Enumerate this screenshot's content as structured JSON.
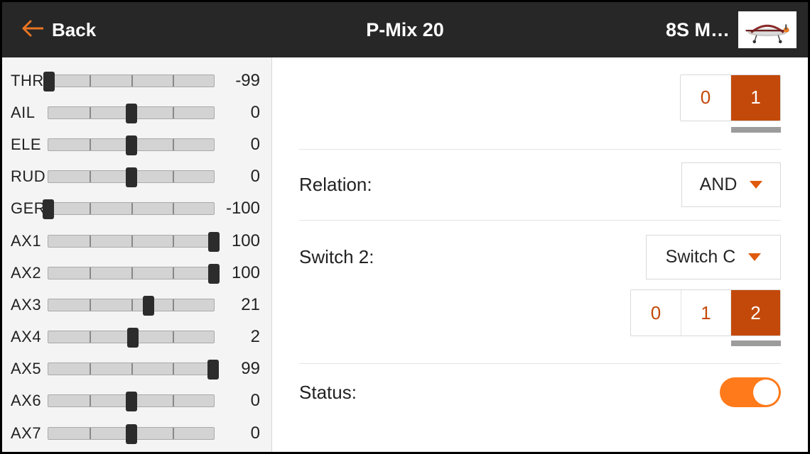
{
  "header": {
    "back_label": "Back",
    "title": "P-Mix 20",
    "model_name": "8S M…"
  },
  "channels": [
    {
      "label": "THR",
      "value": -99
    },
    {
      "label": "AIL",
      "value": 0
    },
    {
      "label": "ELE",
      "value": 0
    },
    {
      "label": "RUD",
      "value": 0
    },
    {
      "label": "GER",
      "value": -100
    },
    {
      "label": "AX1",
      "value": 100
    },
    {
      "label": "AX2",
      "value": 100
    },
    {
      "label": "AX3",
      "value": 21
    },
    {
      "label": "AX4",
      "value": 2
    },
    {
      "label": "AX5",
      "value": 99
    },
    {
      "label": "AX6",
      "value": 0
    },
    {
      "label": "AX7",
      "value": 0
    }
  ],
  "top_segment": {
    "options": [
      "0",
      "1"
    ],
    "active_index": 1
  },
  "relation": {
    "label": "Relation:",
    "value": "AND"
  },
  "switch2": {
    "label": "Switch 2:",
    "value": "Switch C",
    "positions": [
      "0",
      "1",
      "2"
    ],
    "active_index": 2
  },
  "status": {
    "label": "Status:",
    "on": true
  }
}
